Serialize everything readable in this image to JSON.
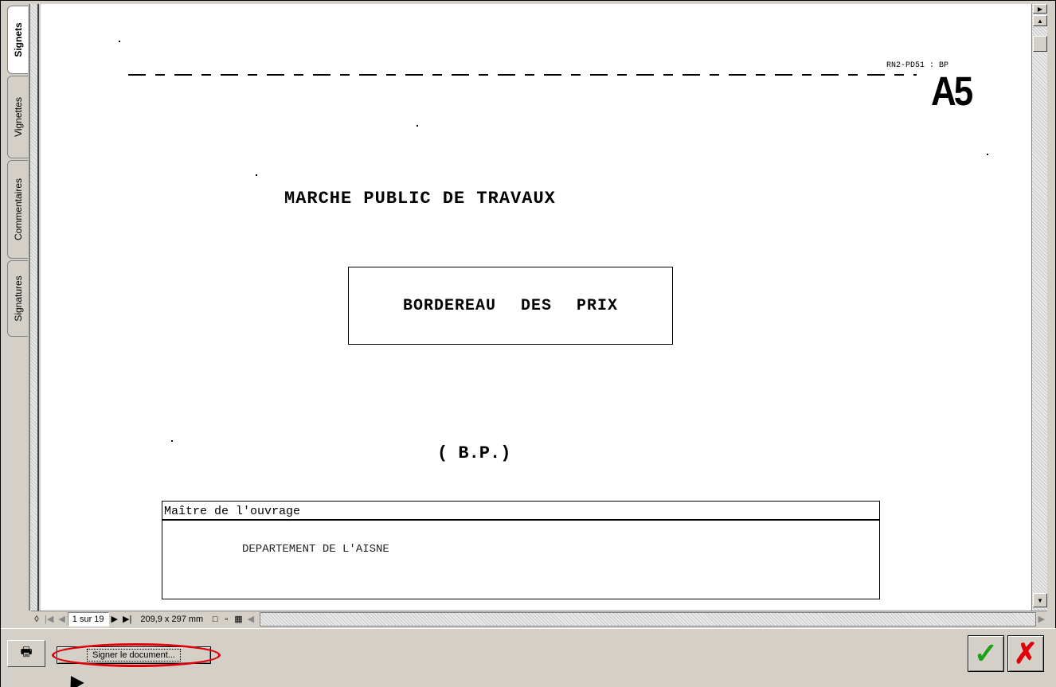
{
  "side_tabs": [
    {
      "label": "Signets",
      "active": true
    },
    {
      "label": "Vignettes",
      "active": false
    },
    {
      "label": "Commentaires",
      "active": false
    },
    {
      "label": "Signatures",
      "active": false
    }
  ],
  "document": {
    "ref_code": "RN2-PD51 : BP",
    "stamp": "A5",
    "title": "MARCHE PUBLIC DE TRAVAUX",
    "boxed_title": "BORDEREAU DES PRIX",
    "abbreviation": "( B.P.)",
    "owner_label": "Maître de l'ouvrage",
    "owner_value": "DEPARTEMENT DE L'AISNE"
  },
  "statusbar": {
    "page_field": "1 sur 19",
    "page_size": "209,9 x 297 mm"
  },
  "icons": {
    "first_page": "first-page-icon",
    "prev_page": "prev-page-icon",
    "next_page": "next-page-icon",
    "last_page": "last-page-icon",
    "single_page": "single-page-icon",
    "continuous": "continuous-icon",
    "continuous_facing": "continuous-facing-icon",
    "print": "print-icon",
    "ok": "checkmark-icon",
    "cancel": "close-icon"
  },
  "toolbar": {
    "sign_label": "Signer le document..."
  },
  "colors": {
    "highlight": "#e0000a",
    "ok": "#1aa01a",
    "cancel": "#e0000a",
    "chrome": "#d4d0c8"
  }
}
